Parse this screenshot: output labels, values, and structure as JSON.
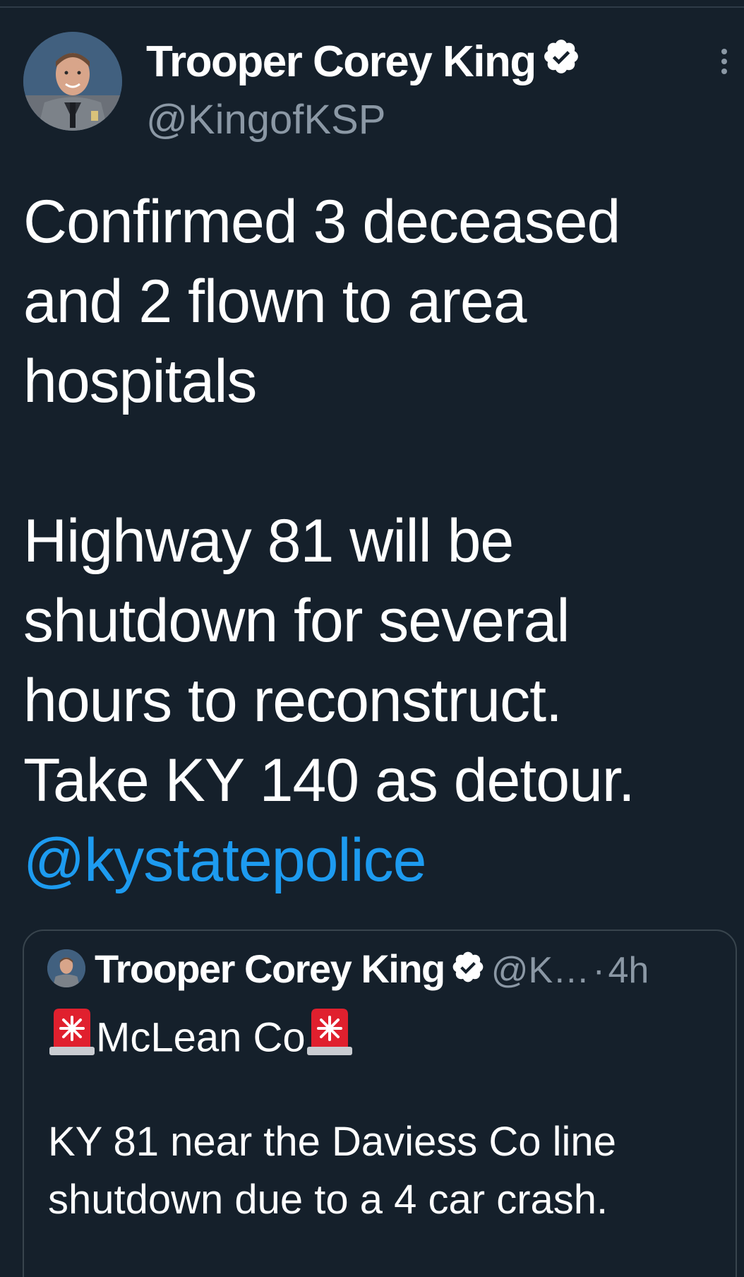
{
  "tweet": {
    "author": {
      "display_name": "Trooper Corey King",
      "handle": "@KingofKSP",
      "verified": true,
      "verified_icon": "verified-badge-icon",
      "avatar_icon": "avatar-photo"
    },
    "more_icon": "vertical-ellipsis-icon",
    "text_lines": [
      "Confirmed 3 deceased",
      "and 2 flown to area",
      "hospitals",
      "Highway 81 will be",
      "shutdown for several",
      "hours to reconstruct.",
      "Take KY 140 as detour."
    ],
    "mention": "@kystatepolice",
    "colors": {
      "background": "#15202b",
      "text": "#ffffff",
      "secondary_text": "#8b98a5",
      "link": "#1d9bf0",
      "border": "#38444d"
    }
  },
  "quoted_tweet": {
    "display_name": "Trooper Corey King",
    "handle": "@K…",
    "separator": "·",
    "time": "4h",
    "verified": true,
    "title": "McLean Co",
    "siren_icon": "police-siren-emoji",
    "text_lines": [
      "KY 81 near the Daviess Co line",
      "shutdown due to a 4 car crash."
    ],
    "truncation": "..."
  }
}
